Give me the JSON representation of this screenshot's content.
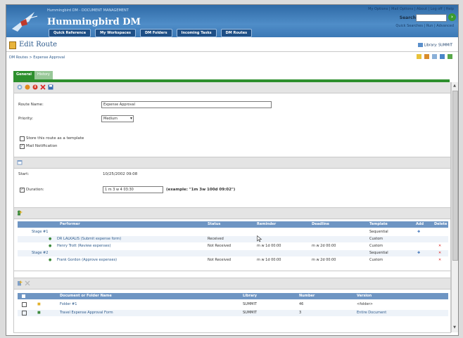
{
  "header": {
    "brand_subtitle": "Hummingbird DM - DOCUMENT MANAGEMENT",
    "brand_title": "Hummingbird DM",
    "nav": [
      "Quick Reference",
      "My Workspaces",
      "DM Folders",
      "Incoming Tasks",
      "DM Routes"
    ],
    "top_links": "My Options | Mail Options | About | Log off | Help",
    "search_label": "Search",
    "search_value": "",
    "search_links": "Quick Searches | Run | Advanced",
    "go_icon": "go-arrow-icon"
  },
  "page": {
    "title": "Edit Route",
    "library_label": "Library: SUMMIT",
    "breadcrumb": "DM Routes > Expense Approval"
  },
  "tabs": [
    {
      "label": "General",
      "active": true
    },
    {
      "label": "History",
      "active": false
    }
  ],
  "form": {
    "route_name_label": "Route Name:",
    "route_name_value": "Expense Approval",
    "priority_label": "Priority:",
    "priority_value": "Medium",
    "store_template_label": "Store this route as a template",
    "store_template_checked": false,
    "mail_notification_label": "Mail Notification",
    "mail_notification_checked": true,
    "start_label": "Start:",
    "start_value": "10/25/2002 09:08",
    "duration_label": "Duration:",
    "duration_checked": true,
    "duration_value": "1 m 3 w 4 03:30",
    "duration_example": "(example: \"1m 3w 100d 09:02\")"
  },
  "performers": {
    "columns": [
      "Performer",
      "Status",
      "Reminder",
      "Deadline",
      "Template",
      "Add",
      "Delete"
    ],
    "rows": [
      {
        "kind": "stage",
        "performer": "Stage #1",
        "status": "",
        "reminder": "",
        "deadline": "",
        "template": "Sequential",
        "add": true,
        "delete": false
      },
      {
        "kind": "task",
        "performer": "DR LALKALIS (Submit expense form)",
        "status": "Received",
        "reminder": "",
        "deadline": "",
        "template": "Custom",
        "add": false,
        "delete": false
      },
      {
        "kind": "task",
        "performer": "Henry Trott (Review expenses)",
        "status": "Not Received",
        "reminder": "m w 1d 00:00",
        "deadline": "m w 2d 00:00",
        "template": "Custom",
        "add": false,
        "delete": true
      },
      {
        "kind": "stage",
        "performer": "Stage #2",
        "status": "",
        "reminder": "",
        "deadline": "",
        "template": "Sequential",
        "add": true,
        "delete": true
      },
      {
        "kind": "task",
        "performer": "Frank Gordon (Approve expenses)",
        "status": "Not Received",
        "reminder": "m w 1d 00:00",
        "deadline": "m w 2d 00:00",
        "template": "Custom",
        "add": false,
        "delete": true
      }
    ]
  },
  "documents": {
    "columns": [
      "Document or Folder Name",
      "Library",
      "Number",
      "Version"
    ],
    "rows": [
      {
        "name": "Folder #1",
        "type": "folder",
        "library": "SUMMIT",
        "number": "46",
        "version": "<folder>"
      },
      {
        "name": "Travel Expense Approval Form",
        "type": "document",
        "library": "SUMMIT",
        "number": "3",
        "version": "Entire Document"
      }
    ]
  }
}
